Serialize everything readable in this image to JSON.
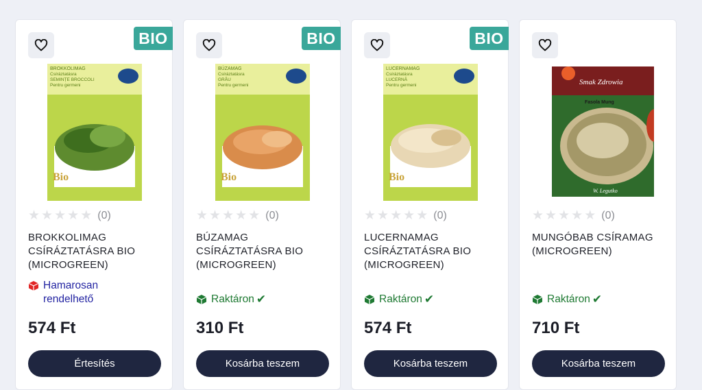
{
  "colors": {
    "badge": "#3aa79a",
    "button": "#1f2640",
    "in_stock": "#1f7a33",
    "coming_soon": "#2324a2"
  },
  "products": [
    {
      "title": "BROKKOLIMAG CSÍRÁZTATÁSRA BIO (MICROGREEN)",
      "badge": "BIO",
      "package_text": [
        "BROKKOLIMAG",
        "Csíráztatásra",
        "SEMINȚE BROCCOLI",
        "Pentru germeni",
        "Bio"
      ],
      "sprout_color": "green",
      "rating_count": "(0)",
      "availability": {
        "status": "coming_soon",
        "text": "Hamarosan rendelhető",
        "icon": "box-red-icon"
      },
      "price": "574 Ft",
      "button_label": "Értesítés"
    },
    {
      "title": "BÚZAMAG CSÍRÁZTATÁSRA BIO (MICROGREEN)",
      "badge": "BIO",
      "package_text": [
        "BÚZAMAG",
        "Csíráztatásra",
        "GRÂU",
        "Pentru germeni",
        "Bio"
      ],
      "sprout_color": "orange",
      "rating_count": "(0)",
      "availability": {
        "status": "in_stock",
        "text": "Raktáron",
        "icon": "box-green-icon"
      },
      "price": "310 Ft",
      "button_label": "Kosárba teszem"
    },
    {
      "title": "LUCERNAMAG CSÍRÁZTATÁSRA BIO (MICROGREEN)",
      "badge": "BIO",
      "package_text": [
        "LUCERNAMAG",
        "Csíráztatásra",
        "LUCERNĂ",
        "Pentru germeni",
        "Bio"
      ],
      "sprout_color": "cream",
      "rating_count": "(0)",
      "availability": {
        "status": "in_stock",
        "text": "Raktáron",
        "icon": "box-green-icon"
      },
      "price": "574 Ft",
      "button_label": "Kosárba teszem"
    },
    {
      "title": "MUNGÓBAB CSÍRAMAG (MICROGREEN)",
      "badge": "",
      "package_text": [
        "Smak Zdrowia",
        "Fasola Mung",
        "W. Legutko"
      ],
      "sprout_color": "mung",
      "rating_count": "(0)",
      "availability": {
        "status": "in_stock",
        "text": "Raktáron",
        "icon": "box-green-icon"
      },
      "price": "710 Ft",
      "button_label": "Kosárba teszem"
    }
  ]
}
